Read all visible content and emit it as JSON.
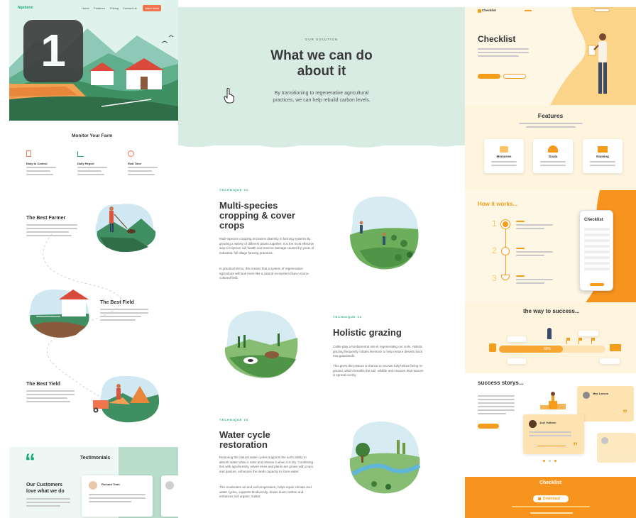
{
  "colors": {
    "mint": "#d9ece4",
    "green": "#19a779",
    "orange": "#f49d1b",
    "coral": "#f0744c",
    "cream": "#fff5df"
  },
  "badge": {
    "number": "1"
  },
  "farm": {
    "logo": "Ngeboon",
    "nav": [
      "Home",
      "Features",
      "Pricing",
      "Contact Us"
    ],
    "nav_button": "Learn More",
    "monitor_title": "Monitor Your Farm",
    "features": [
      {
        "title": "Easy to Control",
        "icon": "document-icon"
      },
      {
        "title": "Daily Report",
        "icon": "chart-icon"
      },
      {
        "title": "Real Time",
        "icon": "clock-icon"
      }
    ],
    "sections": [
      {
        "title": "The Best Farmer"
      },
      {
        "title": "The Best Field"
      },
      {
        "title": "The Best Yield"
      }
    ],
    "testimonials": {
      "quote_mark": "“",
      "heading": "Testimonials",
      "customers_line1": "Our Customers",
      "customers_line2": "love what we do",
      "reviewer": "Richard Tirah"
    }
  },
  "solution": {
    "eyebrow": "OUR SOLUTION",
    "title_line1": "What we can do",
    "title_line2": "about it",
    "subtitle_line1": "By transitioning to regenerative agricultural",
    "subtitle_line2": "practices, we can help rebuild carbon levels.",
    "techniques": [
      {
        "label": "TECHNIQUE 01",
        "title_line1": "Multi-species",
        "title_line2": "cropping & cover",
        "title_line3": "crops",
        "para1": "Multi-Species cropping increases diversity in farming systems by growing a variety of different plants together. It is the most effective way to improve soil health and reverse damage caused by years of industrial, full tillage farming practices.",
        "para2": "In practical terms, this means that a system of regenerative agriculture will look more like a natural ecosystem than a mono-cultured field."
      },
      {
        "label": "TECHNIQUE 02",
        "title_line1": "Holistic grazing",
        "para1": "Cattle play a fundamental role in regenerating our soils. Holistic grazing frequently rotates livestock to help restore deserts back into grasslands.",
        "para2": "This gives the pasture a chance to recover fully before being re-grazed, which benefits the soil, wildlife and ensures that manure is spread evenly."
      },
      {
        "label": "TECHNIQUE 03",
        "title_line1": "Water cycle",
        "title_line2": "restoration",
        "para1": "Restoring the natural water cycles supports the soil's ability to absorb water when it rains and release it when it is dry. Combining this with agroforestry, where trees and plants are grown with crops and pasture, enhances the lands capacity to store water.",
        "para2": "This moderates air and soil temperature, helps repair climate and water cycles, supports biodiversity, draws down carbon and enhances soil organic matter."
      }
    ]
  },
  "checklist": {
    "logo": "Checklist",
    "hero_title": "Checklist",
    "features_title": "Features",
    "feature_cards": [
      "Memories",
      "Goals",
      "Ranking"
    ],
    "how_title": "How it works...",
    "steps": [
      "1",
      "2",
      "3"
    ],
    "phone_title": "Checklist",
    "way_title": "the way to success...",
    "progress_label": "60%",
    "progress": 0.6,
    "stories_title": "success storys...",
    "story_names": [
      "Max Larson",
      "Joel Voltmer"
    ],
    "quote_mark": "”",
    "footer_title": "Checklist",
    "footer_button": "Download"
  }
}
